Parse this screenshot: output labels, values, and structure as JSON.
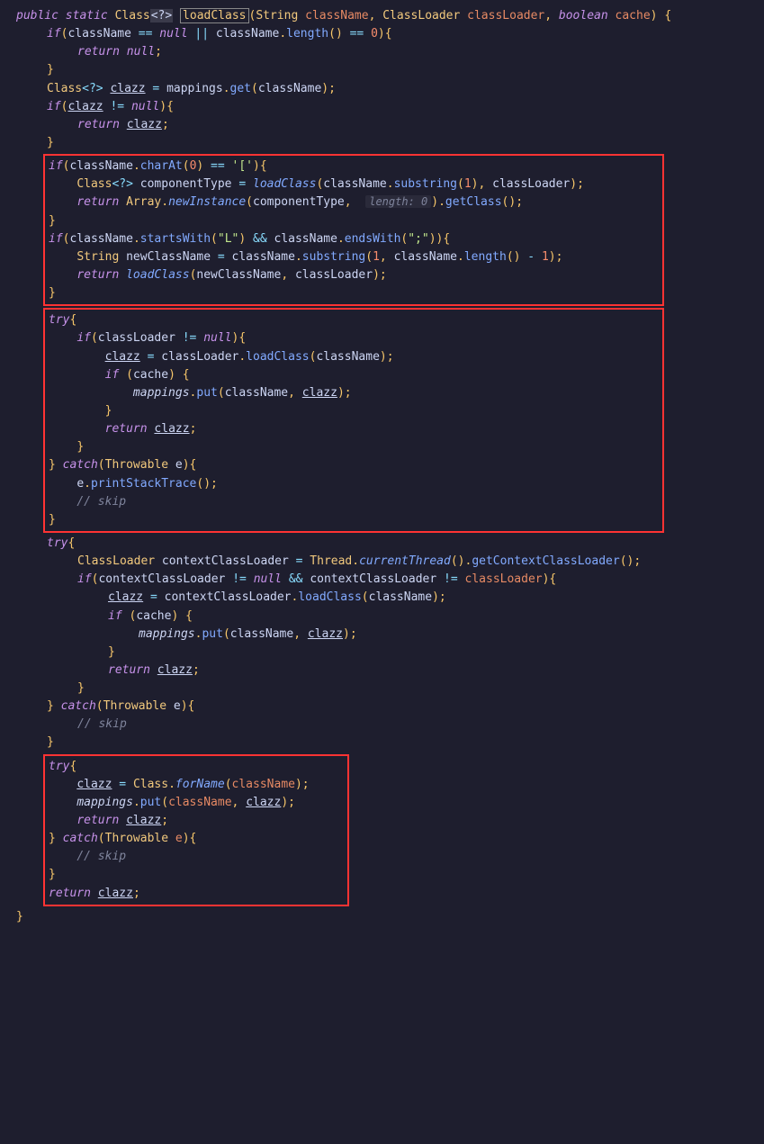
{
  "signature": {
    "mods": [
      "public",
      "static"
    ],
    "return_type": "Class",
    "generic": "<?>",
    "name": "loadClass",
    "params": [
      {
        "type": "String",
        "name": "className"
      },
      {
        "type": "ClassLoader",
        "name": "classLoader"
      },
      {
        "type": "boolean",
        "name": "cache"
      }
    ]
  },
  "lines": {
    "l1_if": "if",
    "l1_cn": "className",
    "l1_eq": "==",
    "l1_null": "null",
    "l1_or": "||",
    "l1_len": "length",
    "l1_eq2": "==",
    "l1_zero": "0",
    "l2_ret": "return",
    "l2_null": "null",
    "l4_type": "Class",
    "l4_gen": "<?>",
    "l4_var": "clazz",
    "l4_eq": "=",
    "l4_map": "mappings",
    "l4_get": "get",
    "l4_cn": "className",
    "l5_if": "if",
    "l5_cz": "clazz",
    "l5_ne": "!=",
    "l5_null": "null",
    "l6_ret": "return",
    "l6_cz": "clazz",
    "b1_l1_if": "if",
    "b1_l1_cn": "className",
    "b1_l1_charAt": "charAt",
    "b1_l1_zero": "0",
    "b1_l1_eq": "==",
    "b1_l1_ch": "'['",
    "b1_l2_type": "Class",
    "b1_l2_gen": "<?>",
    "b1_l2_var": "componentType",
    "b1_l2_eq": "=",
    "b1_l2_load": "loadClass",
    "b1_l2_cn": "className",
    "b1_l2_sub": "substring",
    "b1_l2_one": "1",
    "b1_l2_cl": "classLoader",
    "b1_l3_ret": "return",
    "b1_l3_arr": "Array",
    "b1_l3_ni": "newInstance",
    "b1_l3_ct": "componentType",
    "b1_l3_hint": "length: 0",
    "b1_l3_gc": "getClass",
    "b1_l5_if": "if",
    "b1_l5_cn": "className",
    "b1_l5_sw": "startsWith",
    "b1_l5_L": "\"L\"",
    "b1_l5_and": "&&",
    "b1_l5_cn2": "className",
    "b1_l5_ew": "endsWith",
    "b1_l5_semi": "\";\"",
    "b1_l6_type": "String",
    "b1_l6_var": "newClassName",
    "b1_l6_eq": "=",
    "b1_l6_cn": "className",
    "b1_l6_sub": "substring",
    "b1_l6_one": "1",
    "b1_l6_cn2": "className",
    "b1_l6_len": "length",
    "b1_l6_minus": "-",
    "b1_l6_one2": "1",
    "b1_l7_ret": "return",
    "b1_l7_load": "loadClass",
    "b1_l7_ncn": "newClassName",
    "b1_l7_cl": "classLoader",
    "b2_try": "try",
    "b2_if": "if",
    "b2_cl": "classLoader",
    "b2_ne": "!=",
    "b2_null": "null",
    "b2_cz": "clazz",
    "b2_eq": "=",
    "b2_cl2": "classLoader",
    "b2_lc": "loadClass",
    "b2_cn": "className",
    "b2_if2": "if",
    "b2_cache": "cache",
    "b2_map": "mappings",
    "b2_put": "put",
    "b2_cn2": "className",
    "b2_cz2": "clazz",
    "b2_ret": "return",
    "b2_cz3": "clazz",
    "b2_catch": "catch",
    "b2_thr": "Throwable",
    "b2_e": "e",
    "b2_e2": "e",
    "b2_pst": "printStackTrace",
    "b2_skip": "// skip",
    "c_try": "try",
    "c_type": "ClassLoader",
    "c_var": "contextClassLoader",
    "c_eq": "=",
    "c_thr": "Thread",
    "c_ct": "currentThread",
    "c_gccl": "getContextClassLoader",
    "c_if": "if",
    "c_ccl": "contextClassLoader",
    "c_ne": "!=",
    "c_null": "null",
    "c_and": "&&",
    "c_ccl2": "contextClassLoader",
    "c_ne2": "!=",
    "c_cl": "classLoader",
    "c_cz": "clazz",
    "c_eq2": "=",
    "c_ccl3": "contextClassLoader",
    "c_lc": "loadClass",
    "c_cn": "className",
    "c_if2": "if",
    "c_cache": "cache",
    "c_map": "mappings",
    "c_put": "put",
    "c_cn2": "className",
    "c_cz2": "clazz",
    "c_ret": "return",
    "c_cz3": "clazz",
    "c_catch": "catch",
    "c_tthr": "Throwable",
    "c_e": "e",
    "c_skip": "// skip",
    "b3_try": "try",
    "b3_cz": "clazz",
    "b3_eq": "=",
    "b3_cls": "Class",
    "b3_fn": "forName",
    "b3_cn": "className",
    "b3_map": "mappings",
    "b3_put": "put",
    "b3_cn2": "className",
    "b3_cz2": "clazz",
    "b3_ret": "return",
    "b3_cz3": "clazz",
    "b3_catch": "catch",
    "b3_thr": "Throwable",
    "b3_e": "e",
    "b3_skip": "// skip",
    "b3_ret2": "return",
    "b3_cz4": "clazz"
  }
}
